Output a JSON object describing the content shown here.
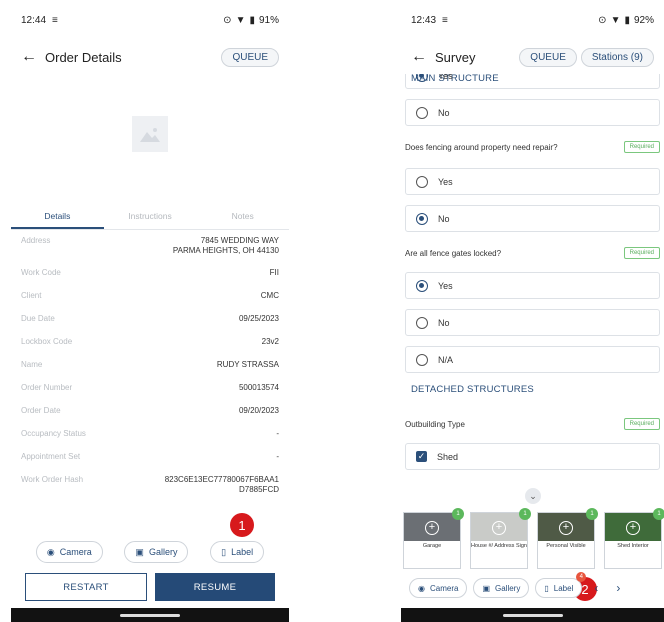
{
  "colors": {
    "primary": "#254a77",
    "required_green": "#5aae5e",
    "step_badge_red": "#d7191c"
  },
  "left": {
    "status": {
      "time": "12:44",
      "battery": "91%"
    },
    "header": {
      "title": "Order Details",
      "queue": "QUEUE"
    },
    "tabs": [
      "Details",
      "Instructions",
      "Notes"
    ],
    "details": [
      {
        "k": "Address",
        "v": "7845 WEDDING WAY\nPARMA HEIGHTS, OH 44130"
      },
      {
        "k": "Work Code",
        "v": "FII"
      },
      {
        "k": "Client",
        "v": "CMC"
      },
      {
        "k": "Due Date",
        "v": "09/25/2023"
      },
      {
        "k": "Lockbox Code",
        "v": "23v2"
      },
      {
        "k": "Name",
        "v": "RUDY STRASSA"
      },
      {
        "k": "Order Number",
        "v": "500013574"
      },
      {
        "k": "Order Date",
        "v": "09/20/2023"
      },
      {
        "k": "Occupancy Status",
        "v": "-"
      },
      {
        "k": "Appointment Set",
        "v": "-"
      },
      {
        "k": "Work Order Hash",
        "v": "823C6E13EC77780067F6BAA1\nD7885FCD"
      }
    ],
    "buttons": {
      "camera": "Camera",
      "gallery": "Gallery",
      "label": "Label",
      "restart": "RESTART",
      "resume": "RESUME"
    },
    "step_badge": "1"
  },
  "right": {
    "status": {
      "time": "12:43",
      "battery": "92%"
    },
    "header": {
      "title": "Survey",
      "queue": "QUEUE",
      "stations": "Stations (9)"
    },
    "sections": {
      "main": "MAIN STRUCTURE",
      "detached": "DETACHED STRUCTURES"
    },
    "questions": {
      "fencing": "Does fencing around property need repair?",
      "gates": "Are all fence gates locked?",
      "outbuilding": "Outbuilding Type"
    },
    "options": {
      "yes": "Yes",
      "no": "No",
      "na": "N/A",
      "shed": "Shed"
    },
    "required": "Required",
    "thumbs": [
      {
        "label": "Garage",
        "count": "1"
      },
      {
        "label": "House #/ Address Sign",
        "count": "1"
      },
      {
        "label": "Personal Visible",
        "count": "1"
      },
      {
        "label": "Shed Interior",
        "count": "1"
      }
    ],
    "buttons": {
      "camera": "Camera",
      "gallery": "Gallery",
      "label": "Label",
      "label_count": "4"
    },
    "step_badge": "2"
  }
}
